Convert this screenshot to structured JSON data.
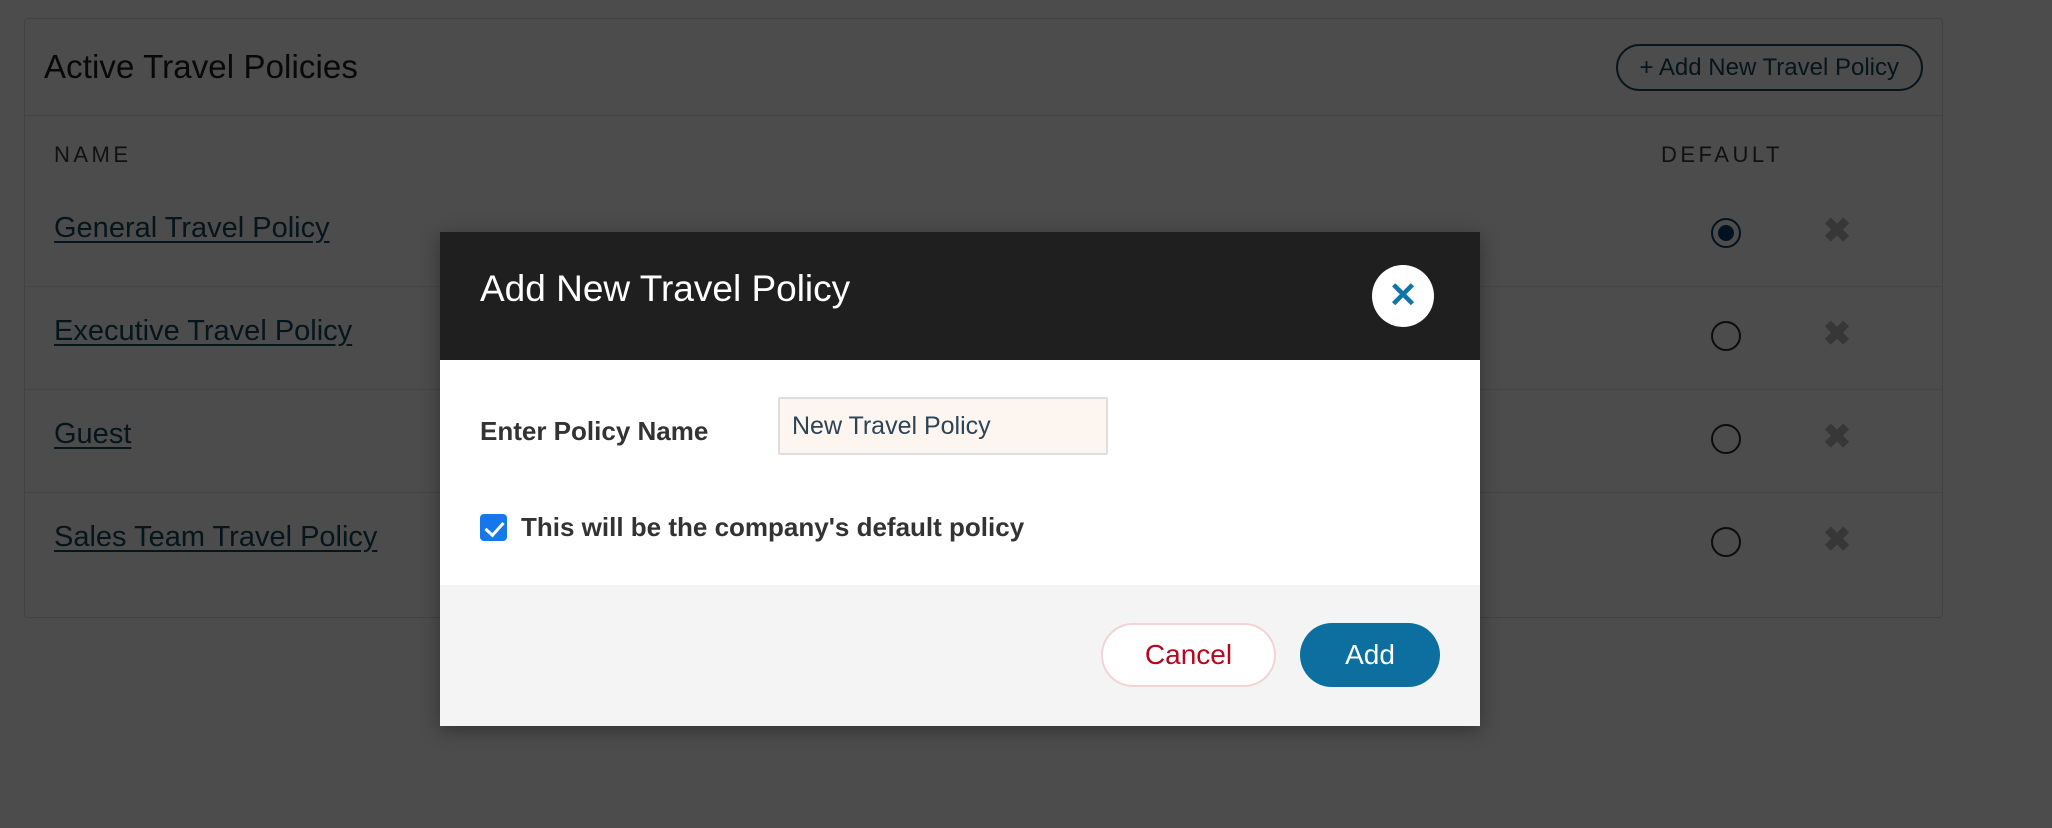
{
  "page": {
    "card": {
      "title": "Active Travel Policies",
      "add_button_label": "+ Add New Travel Policy",
      "columns": {
        "name": "NAME",
        "default": "DEFAULT"
      },
      "rows": [
        {
          "name": "General Travel Policy",
          "is_default": true,
          "delete_icon": "close-icon",
          "delete_glyph": "✖"
        },
        {
          "name": "Executive Travel Policy",
          "is_default": false,
          "delete_icon": "close-icon",
          "delete_glyph": "✖"
        },
        {
          "name": "Guest",
          "is_default": false,
          "delete_icon": "close-icon",
          "delete_glyph": "✖"
        },
        {
          "name": "Sales Team Travel Policy",
          "is_default": false,
          "delete_icon": "close-icon",
          "delete_glyph": "✖"
        }
      ]
    }
  },
  "modal": {
    "title": "Add New Travel Policy",
    "close_icon": "close-icon",
    "close_glyph": "✕",
    "field_label": "Enter Policy Name",
    "field_value": "New Travel Policy",
    "field_placeholder": "Enter Policy Name",
    "checkbox_label": "This will be the company's default policy",
    "checkbox_checked": true,
    "cancel_label": "Cancel",
    "add_label": "Add"
  },
  "colors": {
    "link": "#14475c",
    "accent_blue": "#0c6fa0",
    "checkbox_blue": "#1577ea",
    "cancel_red": "#b5081f",
    "radio_selected": "#0d3f6e",
    "header_dark": "#1f1f1f",
    "footer_grey": "#f4f4f4",
    "input_cream": "#fdf6f0",
    "overlay": "rgba(0,0,0,0.70)"
  }
}
